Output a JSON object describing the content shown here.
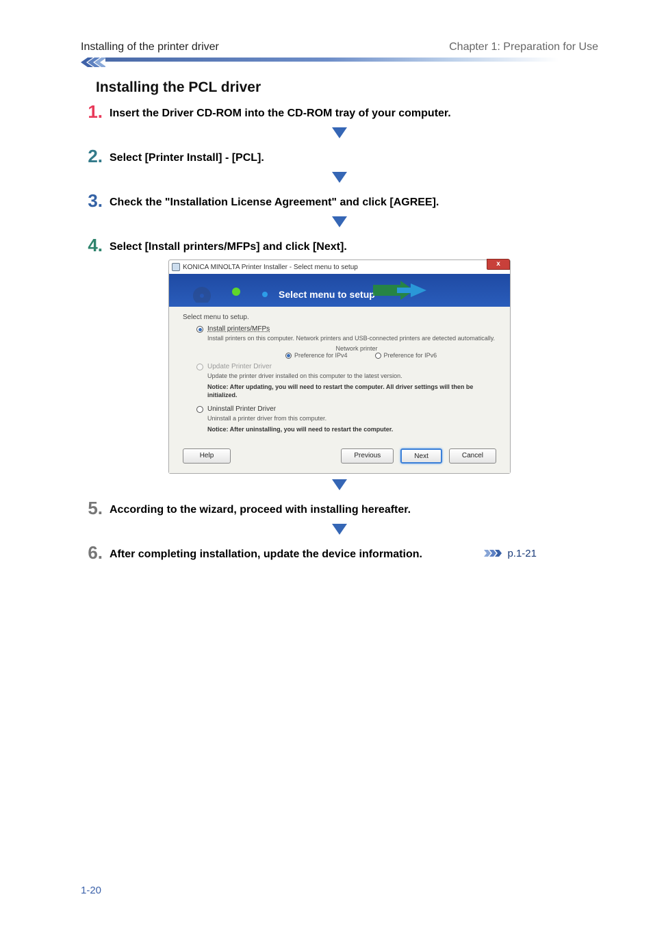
{
  "header": {
    "left": "Installing of the printer driver",
    "right": "Chapter 1: Preparation for Use"
  },
  "section_title": "Installing the PCL driver",
  "steps": {
    "s1": "Insert the Driver CD-ROM into the CD-ROM tray of your computer.",
    "s2": "Select [Printer Install] - [PCL].",
    "s3": "Check the \"Installation License Agreement\" and click [AGREE].",
    "s4": "Select [Install printers/MFPs] and click [Next].",
    "s5": "According to the wizard, proceed with installing hereafter.",
    "s6": "After completing installation, update the device information."
  },
  "dialog": {
    "title": "KONICA MINOLTA Printer Installer - Select menu to setup",
    "close": "x",
    "banner": "Select menu to setup",
    "label_select": "Select menu to setup.",
    "opt_install": "Install printers/MFPs",
    "opt_install_desc": "Install printers on this computer. Network printers and USB-connected printers are detected automatically.",
    "network_label": "Network printer",
    "ipv4": "Preference for IPv4",
    "ipv6": "Preference for IPv6",
    "opt_update": "Update Printer Driver",
    "opt_update_desc": "Update the printer driver installed on this computer to the latest version.",
    "opt_update_notice": "Notice: After updating, you will need to restart the computer. All driver settings will then be initialized.",
    "opt_uninstall": "Uninstall Printer Driver",
    "opt_uninstall_desc": "Uninstall a printer driver from this computer.",
    "opt_uninstall_notice": "Notice: After uninstalling, you will need to restart the computer.",
    "btn_help": "Help",
    "btn_prev": "Previous",
    "btn_next": "Next",
    "btn_cancel": "Cancel"
  },
  "ref_link": "p.1-21",
  "page_number": "1-20"
}
